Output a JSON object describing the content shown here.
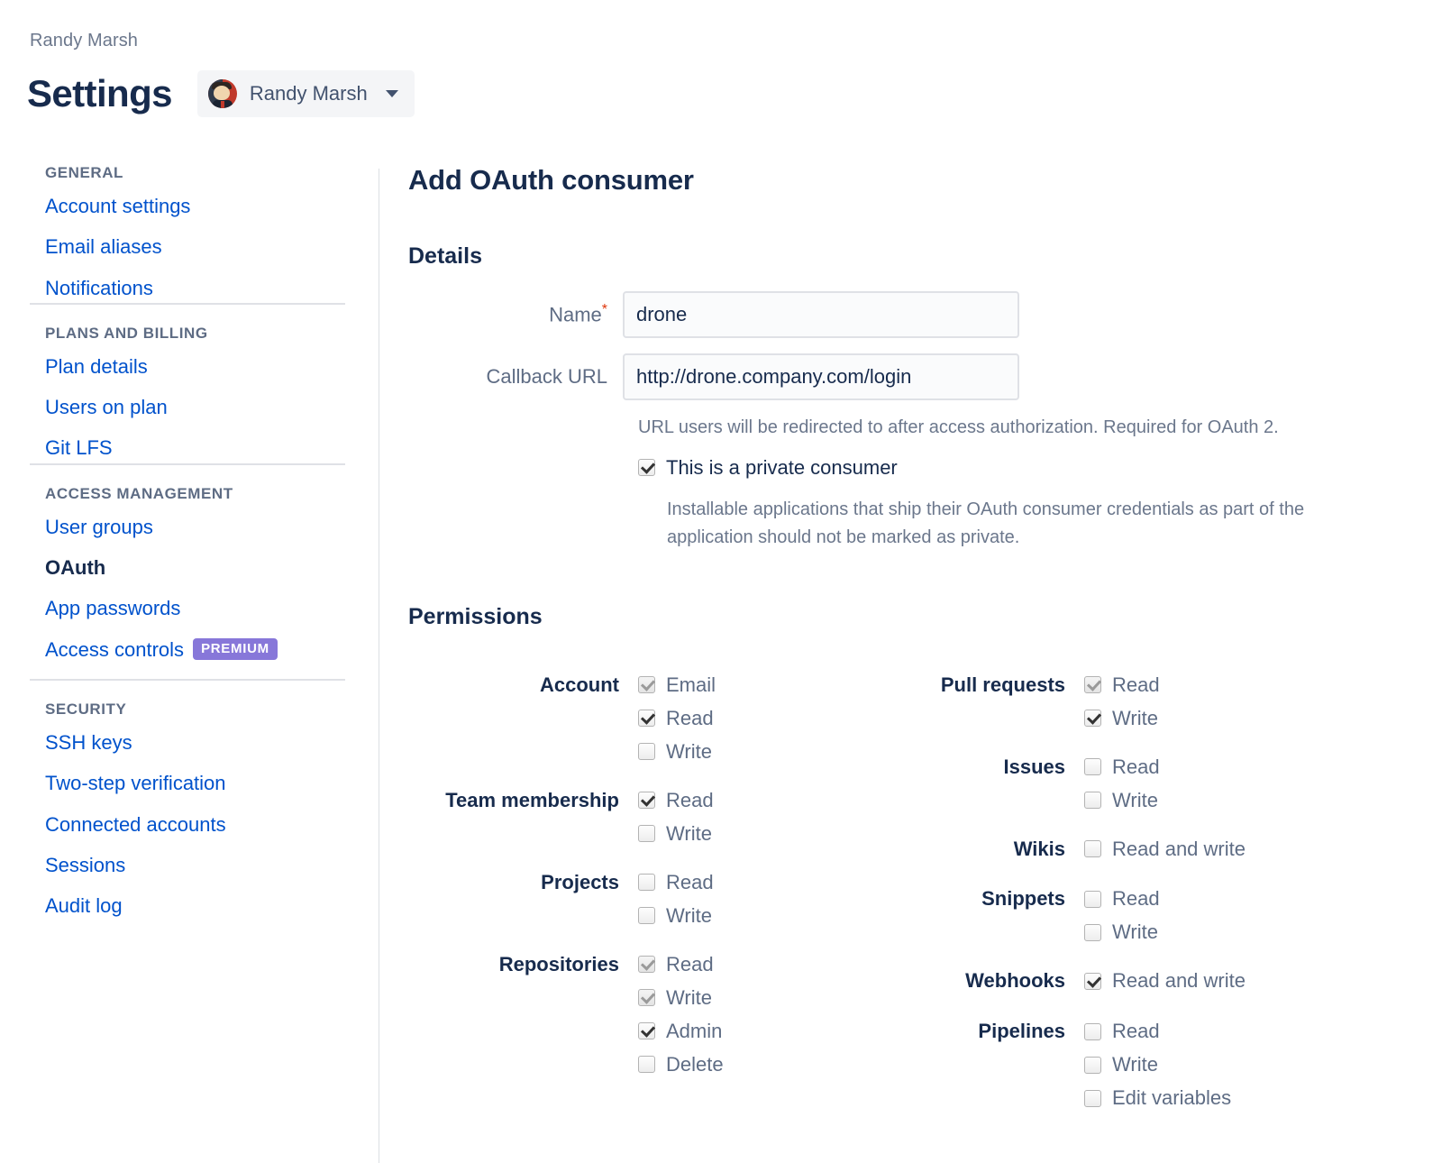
{
  "header": {
    "breadcrumb": "Randy Marsh",
    "title": "Settings",
    "user_chip": {
      "name": "Randy Marsh",
      "avatar_icon": "user-avatar",
      "chevron_icon": "chevron-down-icon"
    }
  },
  "sidebar": {
    "sections": [
      {
        "title": "GENERAL",
        "items": [
          {
            "label": "Account settings",
            "current": false
          },
          {
            "label": "Email aliases",
            "current": false
          },
          {
            "label": "Notifications",
            "current": false
          }
        ]
      },
      {
        "title": "PLANS AND BILLING",
        "items": [
          {
            "label": "Plan details",
            "current": false
          },
          {
            "label": "Users on plan",
            "current": false
          },
          {
            "label": "Git LFS",
            "current": false
          }
        ]
      },
      {
        "title": "ACCESS MANAGEMENT",
        "items": [
          {
            "label": "User groups",
            "current": false
          },
          {
            "label": "OAuth",
            "current": true
          },
          {
            "label": "App passwords",
            "current": false
          },
          {
            "label": "Access controls",
            "current": false,
            "badge": "PREMIUM"
          }
        ]
      },
      {
        "title": "SECURITY",
        "items": [
          {
            "label": "SSH keys",
            "current": false
          },
          {
            "label": "Two-step verification",
            "current": false
          },
          {
            "label": "Connected accounts",
            "current": false
          },
          {
            "label": "Sessions",
            "current": false
          },
          {
            "label": "Audit log",
            "current": false
          }
        ]
      }
    ]
  },
  "main": {
    "title": "Add OAuth consumer",
    "details": {
      "heading": "Details",
      "name_label": "Name",
      "name_required_marker": "*",
      "name_value": "drone",
      "name_placeholder": "",
      "callback_label": "Callback URL",
      "callback_value": "http://drone.company.com/login",
      "callback_placeholder": "",
      "callback_help": "URL users will be redirected to after access authorization. Required for OAuth 2.",
      "private_checkbox_label": "This is a private consumer",
      "private_checkbox_state": "checked",
      "private_help": "Installable applications that ship their OAuth consumer credentials as part of the application should not be marked as private."
    },
    "permissions": {
      "heading": "Permissions",
      "left_column": [
        {
          "label": "Account",
          "options": [
            {
              "label": "Email",
              "state": "implied"
            },
            {
              "label": "Read",
              "state": "checked"
            },
            {
              "label": "Write",
              "state": "unchecked"
            }
          ]
        },
        {
          "label": "Team membership",
          "options": [
            {
              "label": "Read",
              "state": "checked"
            },
            {
              "label": "Write",
              "state": "unchecked"
            }
          ]
        },
        {
          "label": "Projects",
          "options": [
            {
              "label": "Read",
              "state": "unchecked"
            },
            {
              "label": "Write",
              "state": "unchecked"
            }
          ]
        },
        {
          "label": "Repositories",
          "options": [
            {
              "label": "Read",
              "state": "implied"
            },
            {
              "label": "Write",
              "state": "implied"
            },
            {
              "label": "Admin",
              "state": "checked"
            },
            {
              "label": "Delete",
              "state": "unchecked"
            }
          ]
        }
      ],
      "right_column": [
        {
          "label": "Pull requests",
          "options": [
            {
              "label": "Read",
              "state": "implied"
            },
            {
              "label": "Write",
              "state": "checked"
            }
          ]
        },
        {
          "label": "Issues",
          "options": [
            {
              "label": "Read",
              "state": "unchecked"
            },
            {
              "label": "Write",
              "state": "unchecked"
            }
          ]
        },
        {
          "label": "Wikis",
          "options": [
            {
              "label": "Read and write",
              "state": "unchecked"
            }
          ]
        },
        {
          "label": "Snippets",
          "options": [
            {
              "label": "Read",
              "state": "unchecked"
            },
            {
              "label": "Write",
              "state": "unchecked"
            }
          ]
        },
        {
          "label": "Webhooks",
          "options": [
            {
              "label": "Read and write",
              "state": "checked"
            }
          ]
        },
        {
          "label": "Pipelines",
          "options": [
            {
              "label": "Read",
              "state": "unchecked"
            },
            {
              "label": "Write",
              "state": "unchecked"
            },
            {
              "label": "Edit variables",
              "state": "unchecked"
            }
          ]
        }
      ]
    }
  },
  "colors": {
    "link": "#0052cc",
    "text": "#172b4d",
    "subtle": "#5e6c84",
    "premium_badge": "#8777d9",
    "required": "#de350b"
  }
}
